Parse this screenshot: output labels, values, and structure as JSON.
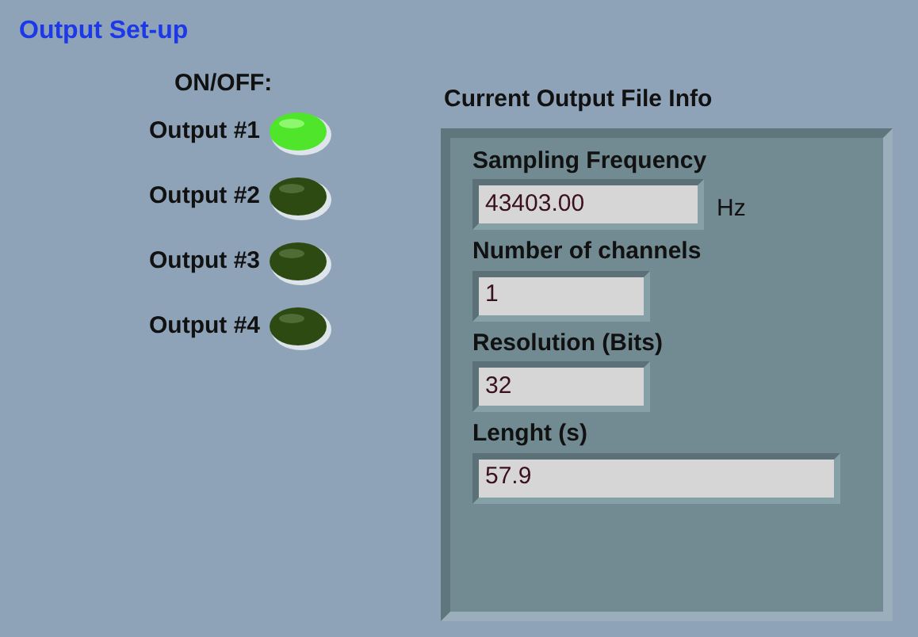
{
  "title": "Output Set-up",
  "onoff_label": "ON/OFF:",
  "outputs": [
    {
      "label": "Output #1",
      "on": true
    },
    {
      "label": "Output #2",
      "on": false
    },
    {
      "label": "Output #3",
      "on": false
    },
    {
      "label": "Output #4",
      "on": false
    }
  ],
  "file_info": {
    "title": "Current Output File Info",
    "fields": [
      {
        "label": "Sampling Frequency",
        "value": "43403.00",
        "unit": "Hz"
      },
      {
        "label": "Number of channels",
        "value": "1"
      },
      {
        "label": "Resolution (Bits)",
        "value": "32"
      },
      {
        "label": "Lenght (s)",
        "value": "57.9"
      }
    ]
  }
}
